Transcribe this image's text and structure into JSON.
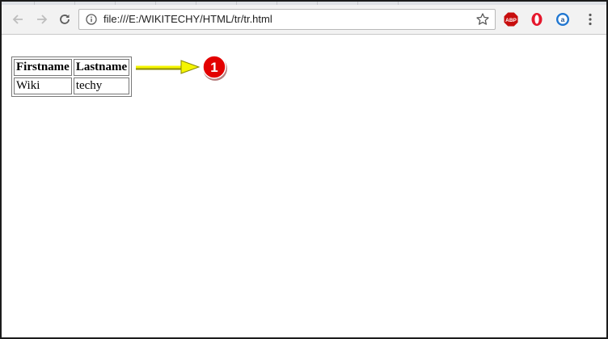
{
  "browser": {
    "url": "file:///E:/WIKITECHY/HTML/tr/tr.html",
    "extensions": [
      {
        "name": "adblock-plus-icon",
        "label": "ABP"
      },
      {
        "name": "opera-icon",
        "label": ""
      },
      {
        "name": "amazon-assistant-icon",
        "label": "a"
      }
    ]
  },
  "table": {
    "headers": [
      "Firstname",
      "Lastname"
    ],
    "rows": [
      [
        "Wiki",
        "techy"
      ]
    ]
  },
  "annotation": {
    "badge_number": "1",
    "badge_color": "#e30000",
    "arrow_color": "#f5f500"
  }
}
